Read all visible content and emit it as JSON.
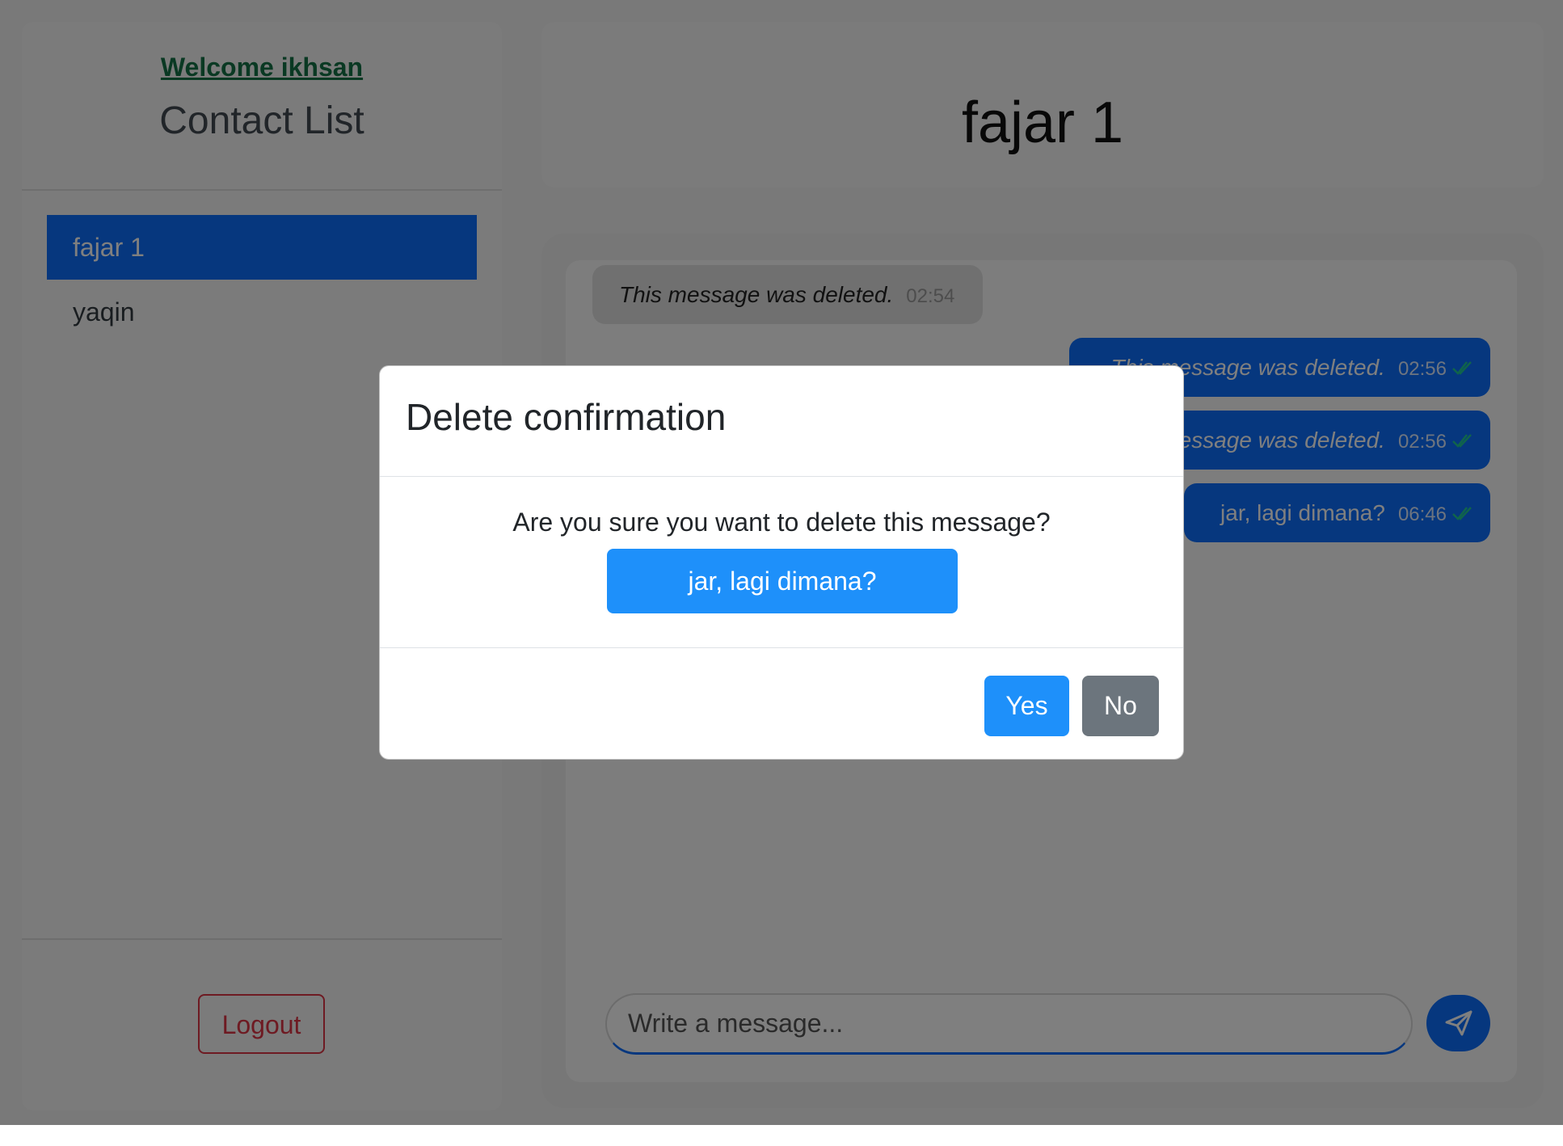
{
  "sidebar": {
    "welcome": "Welcome ikhsan",
    "title": "Contact List",
    "contacts": [
      {
        "name": "fajar 1",
        "active": true
      },
      {
        "name": "yaqin",
        "active": false
      }
    ],
    "logout_label": "Logout"
  },
  "chat": {
    "title": "fajar 1",
    "messages": [
      {
        "direction": "received",
        "text": "This message was deleted.",
        "time": "02:54",
        "deleted": true
      },
      {
        "direction": "sent",
        "text": "This message was deleted.",
        "time": "02:56",
        "deleted": true,
        "read": true
      },
      {
        "direction": "sent",
        "text": "This message was deleted.",
        "time": "02:56",
        "deleted": true,
        "read": true
      },
      {
        "direction": "sent",
        "text": "jar, lagi dimana?",
        "time": "06:46",
        "deleted": false,
        "read": true
      }
    ],
    "input_placeholder": "Write a message...",
    "send_icon": "paper-plane-icon"
  },
  "modal": {
    "title": "Delete confirmation",
    "question": "Are you sure you want to delete this message?",
    "quoted_message": "jar, lagi dimana?",
    "yes_label": "Yes",
    "no_label": "No"
  },
  "colors": {
    "primary": "#0d6efd",
    "welcome_green": "#157347",
    "danger": "#dc3545",
    "secondary": "#6c757d",
    "read_check": "#20c997"
  }
}
